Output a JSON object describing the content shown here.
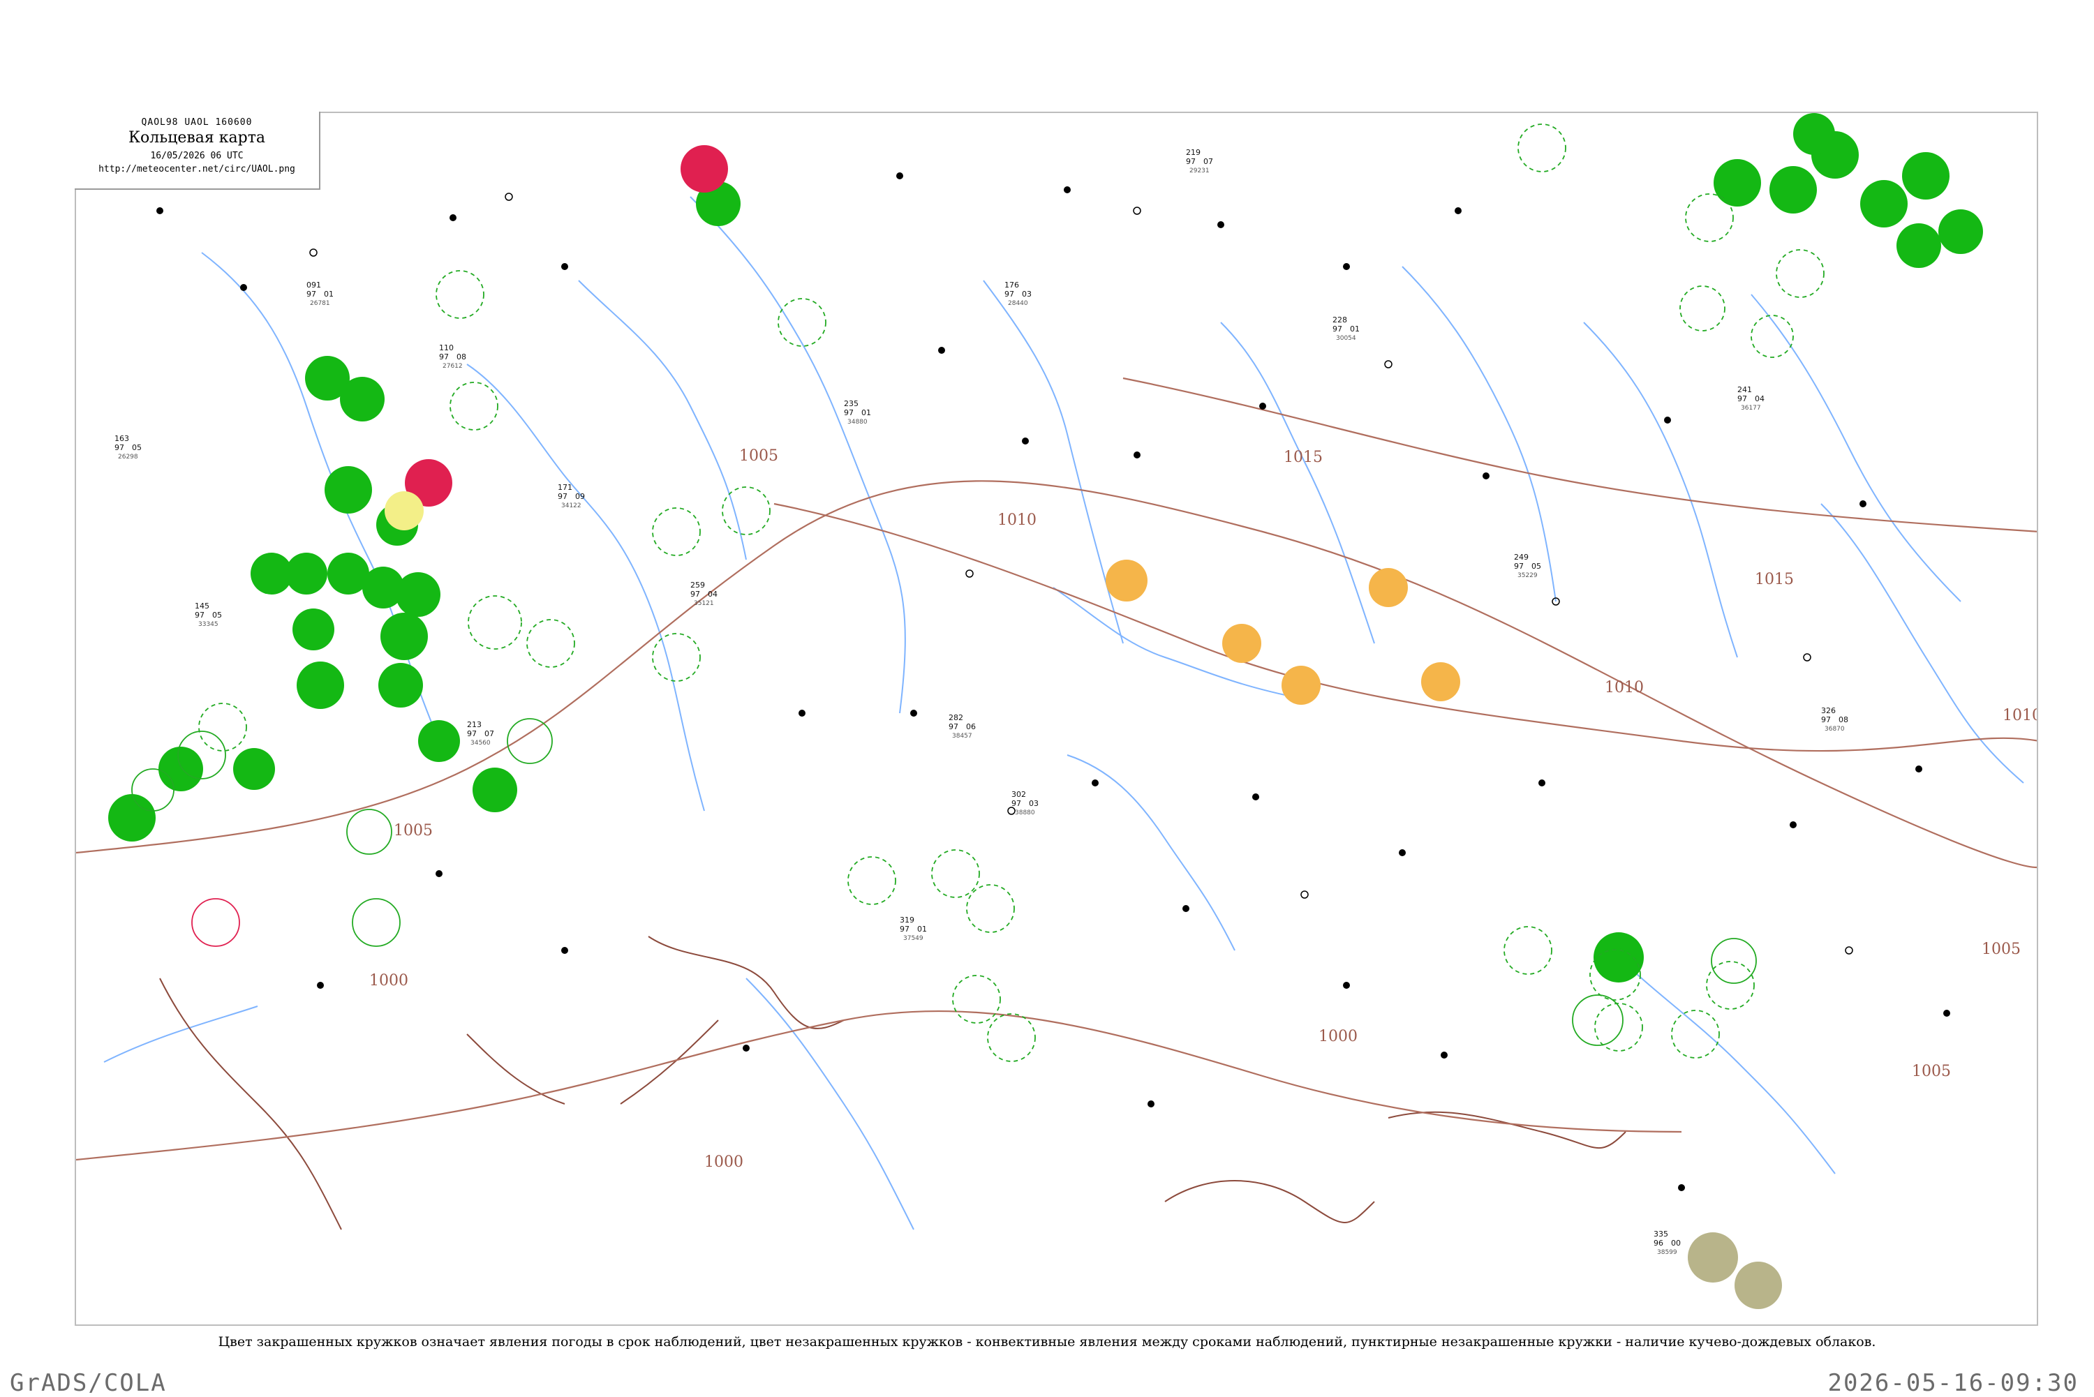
{
  "header": {
    "codes": "QAOL98  UAOL  160600",
    "title": "Кольцевая карта",
    "datetime": "16/05/2026 06 UTC",
    "url": "http://meteocenter.net/circ/UAOL.png"
  },
  "legend_note": "Цвет закрашенных кружков означает явления погоды в срок наблюдений, цвет незакрашенных кружков - конвективные явления между сроками наблюдений, пунктирные незакрашенные кружки - наличие кучево-дождевых облаков.",
  "footer": {
    "credit": "GrADS/COLA",
    "timestamp": "2026-05-16-09:30"
  },
  "colors": {
    "isobar": "#9b5a4c",
    "river": "#7fb4ff",
    "rain": "#14b814",
    "thunder": "#e02050",
    "shower": "#f5b54a",
    "drizzle": "#f3ef88",
    "dust": "#b8b48a",
    "cb_dashed": "#22aa22"
  },
  "isobars": [
    {
      "label": "1000"
    },
    {
      "label": "1005"
    },
    {
      "label": "1010"
    },
    {
      "label": "1015"
    }
  ],
  "stations": [
    {
      "id": "26298",
      "temp": "163",
      "press": "97",
      "dew": "05"
    },
    {
      "id": "26781",
      "temp": "091",
      "press": "97",
      "dew": "01"
    },
    {
      "id": "27612",
      "temp": "110",
      "press": "97",
      "dew": "08"
    },
    {
      "id": "28440",
      "temp": "176",
      "press": "97",
      "dew": "03"
    },
    {
      "id": "29231",
      "temp": "219",
      "press": "97",
      "dew": "07"
    },
    {
      "id": "30054",
      "temp": "228",
      "press": "97",
      "dew": "01"
    },
    {
      "id": "34122",
      "temp": "171",
      "press": "97",
      "dew": "09"
    },
    {
      "id": "34880",
      "temp": "235",
      "press": "97",
      "dew": "01"
    },
    {
      "id": "35229",
      "temp": "249",
      "press": "97",
      "dew": "05"
    },
    {
      "id": "36177",
      "temp": "241",
      "press": "97",
      "dew": "04"
    },
    {
      "id": "38457",
      "temp": "282",
      "press": "97",
      "dew": "06"
    },
    {
      "id": "38880",
      "temp": "302",
      "press": "97",
      "dew": "03"
    },
    {
      "id": "33345",
      "temp": "145",
      "press": "97",
      "dew": "05"
    },
    {
      "id": "34560",
      "temp": "213",
      "press": "97",
      "dew": "07"
    },
    {
      "id": "35121",
      "temp": "259",
      "press": "97",
      "dew": "04"
    },
    {
      "id": "36870",
      "temp": "326",
      "press": "97",
      "dew": "08"
    },
    {
      "id": "37549",
      "temp": "319",
      "press": "97",
      "dew": "01"
    },
    {
      "id": "38599",
      "temp": "335",
      "press": "96",
      "dew": "00"
    }
  ]
}
